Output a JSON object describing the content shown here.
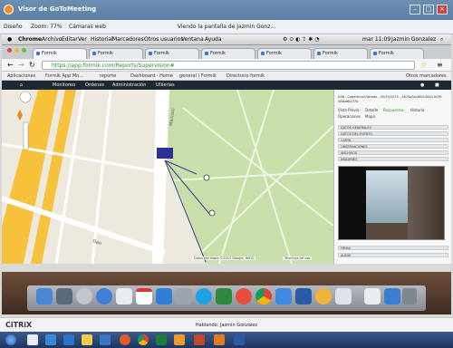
{
  "gtm": {
    "title": "Visor de GoToMeeting",
    "menu_view": "Diseño",
    "menu_zoom": "Zoom: 77%",
    "menu_cameras": "Cámaras web",
    "viewing_text": "Viendo la pantalla de Jazmin Gonz..."
  },
  "mac_menu": {
    "app": "Chrome",
    "items": [
      "Archivo",
      "Editar",
      "Ver",
      "Historial",
      "Marcadores",
      "Otros usuarios",
      "Ventana",
      "Ayuda"
    ],
    "clock": "mar 11:09",
    "user": "Jazmin Gonzalez"
  },
  "chrome": {
    "tabs": [
      "Formik",
      "Formik",
      "Formik",
      "Formik",
      "Formik",
      "Formik",
      "Formik"
    ],
    "url": "https://app.formik.com/Reports/Supervision#",
    "bookmarks": [
      "Aplicaciones",
      "Formik App Mo...",
      "reporte",
      "Dashboard - Home",
      "general | Formik",
      "Directorio formik"
    ],
    "other_bookmarks": "Otros marcadores"
  },
  "app": {
    "nav": [
      "Monitoreo",
      "Ordenes",
      "Administración",
      "Utilerias"
    ],
    "map_attribution": "Datos del mapa ©2015 Google, INEGI",
    "map_terms": "Términos de uso",
    "street_1": "Marconi",
    "street_2": "Gao"
  },
  "panel": {
    "header": "EAB - Cobertura/Visitado - 05/10/2015 - 4870a9a/460f-4440-b09f-4f8ad6e1f7b",
    "tabs": [
      "Vista Previa",
      "Detalle",
      "Respuestas",
      "Historia"
    ],
    "tabs2": [
      "Operaciones",
      "Mapa"
    ],
    "sections": [
      "DATOS GENERALES",
      "DATOS DEL EVENTO",
      "CARTA",
      "OBSERVACIONES",
      "ARCHIVOS",
      "IMÁGENES"
    ],
    "bottom_sections": [
      "FIRMA",
      "AUDIO"
    ]
  },
  "citrix": {
    "logo": "CiTRiX",
    "speaking": "Hablando: Jazmin Gonzalez"
  }
}
